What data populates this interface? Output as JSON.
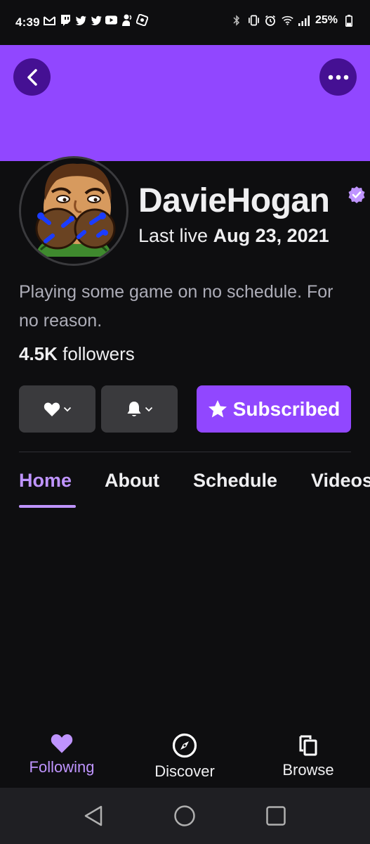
{
  "status_bar": {
    "time": "4:39",
    "battery": "25%",
    "left_icons": [
      "gmail-icon",
      "twitch-icon",
      "twitter-icon",
      "twitter-icon",
      "youtube-icon",
      "voice-icon",
      "app-icon"
    ],
    "right_icons": [
      "bluetooth-icon",
      "vibrate-icon",
      "alarm-icon",
      "wifi-icon",
      "signal-icon",
      "battery-icon"
    ]
  },
  "header": {
    "back_icon": "chevron-left-icon",
    "more_icon": "more-horizontal-icon",
    "banner_color": "#9147ff"
  },
  "channel": {
    "name": "DavieHogan",
    "verified_icon": "verified-check-icon",
    "last_live_prefix": "Last live",
    "last_live_date": "Aug 23, 2021",
    "bio": "Playing some game on no schedule. For no reason.",
    "followers_count": "4.5K",
    "followers_label": "followers"
  },
  "actions": {
    "follow_icon": "heart-icon",
    "notify_icon": "bell-icon",
    "subscribe_label": "Subscribed",
    "subscribe_icon": "star-icon"
  },
  "tabs": [
    {
      "label": "Home",
      "active": true
    },
    {
      "label": "About",
      "active": false
    },
    {
      "label": "Schedule",
      "active": false
    },
    {
      "label": "Videos",
      "active": false
    }
  ],
  "bottom_nav": [
    {
      "label": "Following",
      "icon": "heart-icon",
      "active": true
    },
    {
      "label": "Discover",
      "icon": "compass-icon",
      "active": false
    },
    {
      "label": "Browse",
      "icon": "browse-icon",
      "active": false
    }
  ],
  "colors": {
    "accent": "#9147ff",
    "accent_light": "#bf94ff",
    "background": "#0e0e10",
    "button_gray": "#3a3a3d"
  }
}
